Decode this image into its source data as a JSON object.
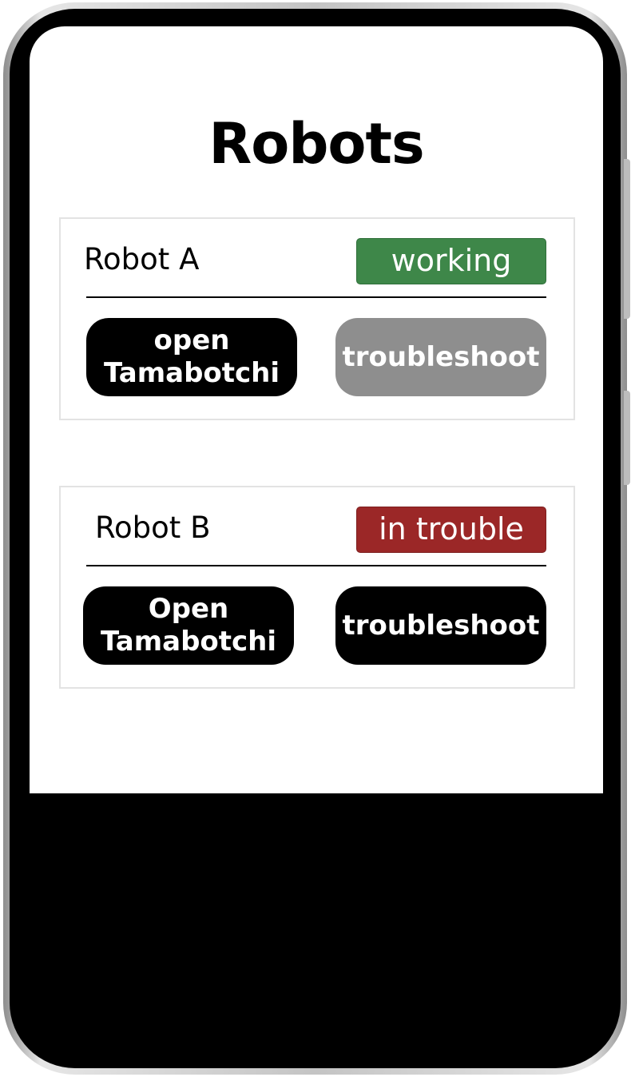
{
  "screen": {
    "title": "Robots"
  },
  "robots": [
    {
      "name": "Robot A",
      "status": "working",
      "status_color": "#3e8749",
      "open_label": "open\nTamabotchi",
      "troubleshoot_label": "troubleshoot",
      "troubleshoot_color": "#8e8e8e"
    },
    {
      "name": "Robot B",
      "status": "in trouble",
      "status_color": "#9b2727",
      "open_label": "Open\nTamabotchi",
      "troubleshoot_label": "troubleshoot",
      "troubleshoot_color": "#000000"
    }
  ]
}
